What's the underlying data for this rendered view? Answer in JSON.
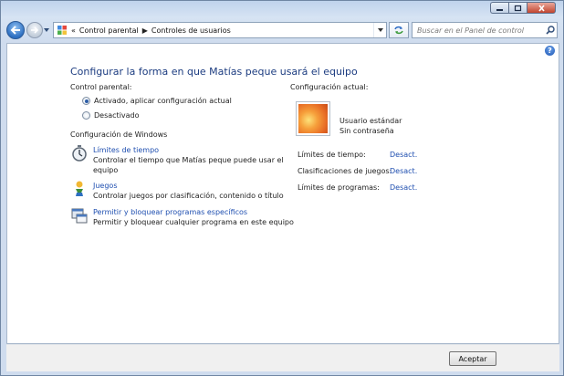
{
  "nav": {
    "breadcrumb_sep": "«",
    "breadcrumb": [
      "Control parental",
      "Controles de usuarios"
    ],
    "search_placeholder": "Buscar en el Panel de control"
  },
  "content": {
    "title": "Configurar la forma en que Matías peque usará el equipo",
    "help_label": "?",
    "parental": {
      "label": "Control parental:",
      "options": [
        {
          "label": "Activado, aplicar configuración actual",
          "selected": true
        },
        {
          "label": "Desactivado",
          "selected": false
        }
      ]
    },
    "windows_settings": {
      "label": "Configuración de Windows",
      "items": [
        {
          "icon": "stopwatch-icon",
          "link": "Límites de tiempo",
          "desc": [
            "Controlar el tiempo que Matías peque puede usar el",
            "equipo"
          ]
        },
        {
          "icon": "games-icon",
          "link": "Juegos",
          "desc": [
            "Controlar juegos por clasificación, contenido o título"
          ]
        },
        {
          "icon": "programs-icon",
          "link": "Permitir y bloquear programas específicos",
          "desc": [
            "Permitir y bloquear cualquier programa en este equipo"
          ]
        }
      ]
    },
    "current": {
      "label": "Configuración actual:",
      "user_type": "Usuario estándar",
      "password": "Sin contraseña",
      "rows": [
        {
          "label": "Límites de tiempo:",
          "value": "Desact."
        },
        {
          "label": "Clasificaciones de juegos:",
          "value": "Desact."
        },
        {
          "label": "Límites de programas:",
          "value": "Desact."
        }
      ]
    }
  },
  "footer": {
    "accept_label": "Aceptar"
  },
  "colors": {
    "link": "#1f4fb0",
    "title": "#1c3c80"
  }
}
